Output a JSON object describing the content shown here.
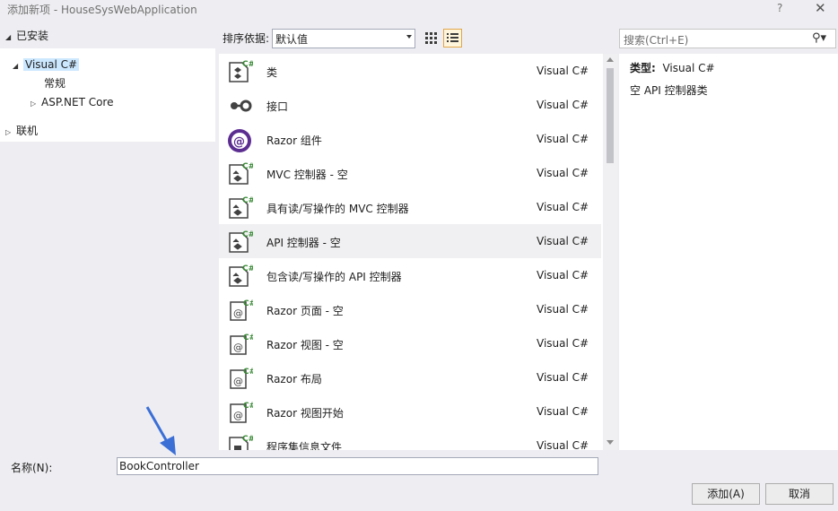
{
  "window": {
    "title": "添加新项 - HouseSysWebApplication",
    "help_label": "?",
    "close_label": "✕"
  },
  "left": {
    "installed": "已安装",
    "visual_csharp": "Visual C#",
    "general": "常规",
    "aspnet_core": "ASP.NET Core",
    "online": "联机"
  },
  "toolbar": {
    "sort_label": "排序依据:",
    "sort_value": "默认值",
    "search_placeholder": "搜索(Ctrl+E)"
  },
  "items": [
    {
      "name": "类",
      "lang": "Visual C#",
      "icon": "csharp-class-icon"
    },
    {
      "name": "接口",
      "lang": "Visual C#",
      "icon": "interface-icon"
    },
    {
      "name": "Razor 组件",
      "lang": "Visual C#",
      "icon": "razor-component-icon"
    },
    {
      "name": "MVC 控制器 - 空",
      "lang": "Visual C#",
      "icon": "csharp-controller-icon"
    },
    {
      "name": "具有读/写操作的 MVC 控制器",
      "lang": "Visual C#",
      "icon": "csharp-controller-icon"
    },
    {
      "name": "API 控制器 - 空",
      "lang": "Visual C#",
      "icon": "csharp-controller-icon"
    },
    {
      "name": "包含读/写操作的 API 控制器",
      "lang": "Visual C#",
      "icon": "csharp-controller-icon"
    },
    {
      "name": "Razor 页面 - 空",
      "lang": "Visual C#",
      "icon": "razor-page-icon"
    },
    {
      "name": "Razor 视图 - 空",
      "lang": "Visual C#",
      "icon": "razor-page-icon"
    },
    {
      "name": "Razor 布局",
      "lang": "Visual C#",
      "icon": "razor-page-icon"
    },
    {
      "name": "Razor 视图开始",
      "lang": "Visual C#",
      "icon": "razor-page-icon"
    },
    {
      "name": "程序集信息文件",
      "lang": "Visual C#",
      "icon": "csharp-file-icon"
    }
  ],
  "selected_index": 5,
  "detail": {
    "type_label": "类型:",
    "type_value": "Visual C#",
    "description": "空 API 控制器类"
  },
  "bottom": {
    "name_label": "名称(N):",
    "name_value": "BookController",
    "add_button": "添加(A)",
    "cancel_button": "取消"
  },
  "colors": {
    "accent_selection": "#cce8ff",
    "csharp_badge": "#388a34",
    "razor_purple": "#5c2d91",
    "arrow_blue": "#3b6fd6"
  }
}
